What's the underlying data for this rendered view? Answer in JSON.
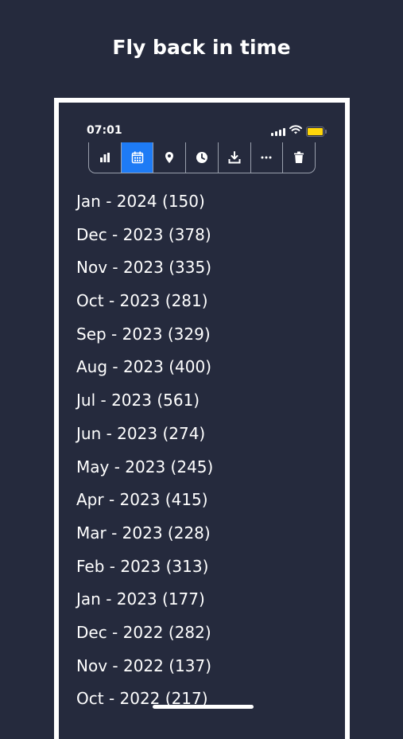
{
  "headline": "Fly back in time",
  "status_bar": {
    "time": "07:01",
    "battery_color": "#ffd60a"
  },
  "toolbar": {
    "active_color": "#1e7bf5",
    "tools": [
      {
        "icon": "bar-chart-icon",
        "active": false
      },
      {
        "icon": "calendar-icon",
        "active": true
      },
      {
        "icon": "map-pin-icon",
        "active": false
      },
      {
        "icon": "clock-icon",
        "active": false
      },
      {
        "icon": "download-icon",
        "active": false
      },
      {
        "icon": "more-icon",
        "active": false
      },
      {
        "icon": "trash-icon",
        "active": false
      }
    ]
  },
  "months": [
    "Jan - 2024 (150)",
    "Dec - 2023 (378)",
    "Nov - 2023 (335)",
    "Oct - 2023 (281)",
    "Sep - 2023 (329)",
    "Aug - 2023 (400)",
    "Jul - 2023 (561)",
    "Jun - 2023 (274)",
    "May - 2023 (245)",
    "Apr - 2023 (415)",
    "Mar - 2023 (228)",
    "Feb - 2023 (313)",
    "Jan - 2023 (177)",
    "Dec - 2022 (282)",
    "Nov - 2022 (137)",
    "Oct - 2022 (217)"
  ],
  "colors": {
    "background": "#252a3d",
    "frame": "#ffffff"
  }
}
